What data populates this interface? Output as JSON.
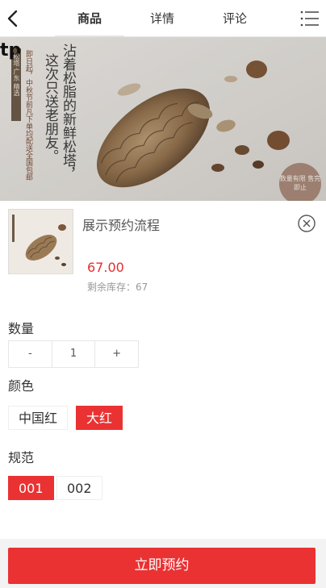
{
  "nav": {
    "tabs": [
      {
        "label": "商品"
      },
      {
        "label": "详情"
      },
      {
        "label": "评论"
      }
    ],
    "active_tab": 0
  },
  "banner": {
    "corner_text": "tp",
    "headline_lines": [
      "沾着松脂的新鲜松塔，",
      "这次只送老朋友。"
    ],
    "small_lines": [
      "即日起，中秋节前凡下单均配送全国包邮"
    ],
    "tag": "松塔 广东 精选",
    "seal_text": "数量有限 售完即止"
  },
  "product": {
    "title": "展示预约流程",
    "price": "67.00",
    "stock": "剩余库存：67"
  },
  "quantity": {
    "label": "数量",
    "minus": "-",
    "value": "1",
    "plus": "+"
  },
  "color": {
    "label": "颜色",
    "options": [
      "中国红",
      "大红"
    ],
    "selected": "大红"
  },
  "spec": {
    "label": "规范",
    "options": [
      "001",
      "002"
    ],
    "selected": "001"
  },
  "cta": {
    "label": "立即预约"
  },
  "colors": {
    "accent": "#ea3233",
    "price": "#e42e2e"
  },
  "icons": [
    "back-arrow-icon",
    "menu-icon",
    "close-circle-icon"
  ]
}
